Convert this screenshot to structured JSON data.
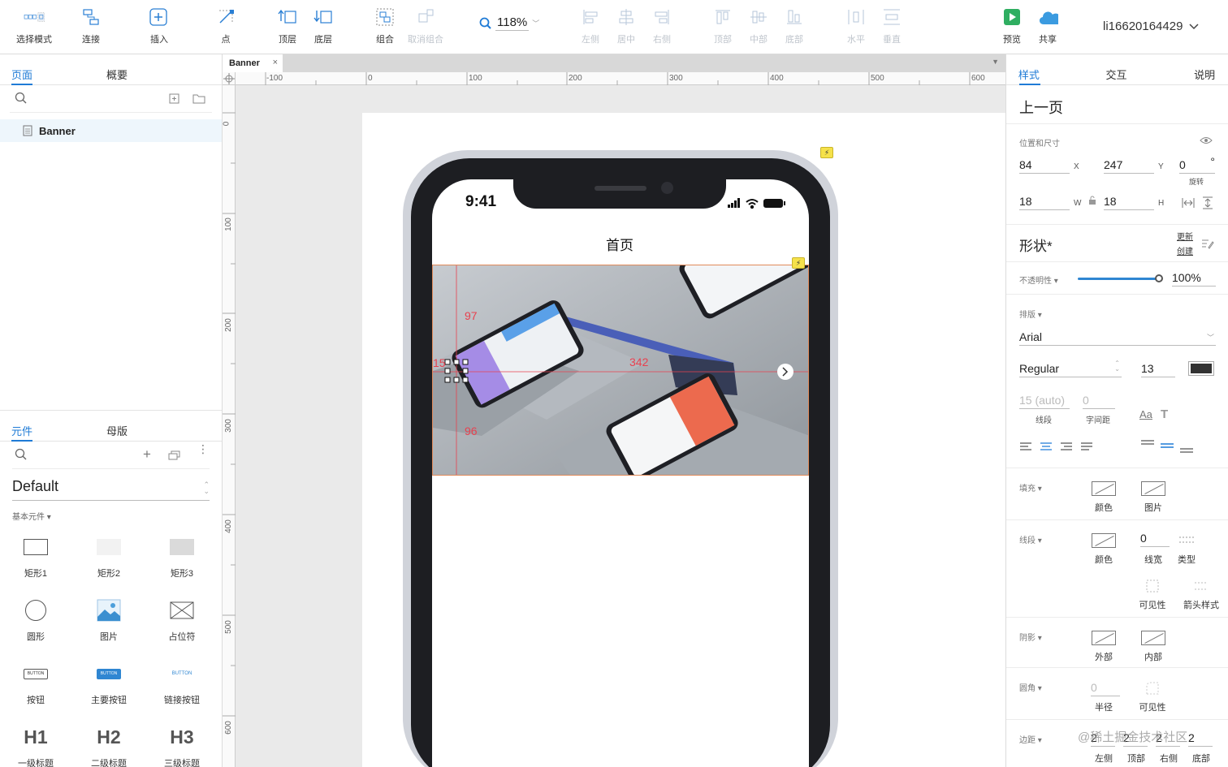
{
  "toolbar": {
    "select_mode": "选择模式",
    "connect": "连接",
    "insert": "插入",
    "point": "点",
    "top_layer": "顶层",
    "bottom_layer": "底层",
    "group": "组合",
    "ungroup": "取消组合",
    "zoom": "118%",
    "align_left": "左侧",
    "align_center": "居中",
    "align_right": "右侧",
    "align_top": "顶部",
    "align_middle": "中部",
    "align_bottom": "底部",
    "distribute_h": "水平",
    "distribute_v": "垂直",
    "preview": "预览",
    "share": "共享",
    "user": "li16620164429"
  },
  "left": {
    "tab_pages": "页面",
    "tab_outline": "概要",
    "page_name": "Banner",
    "tab_widgets": "元件",
    "tab_masters": "母版",
    "library": "Default",
    "category": "基本元件 ▾",
    "widgets": [
      {
        "label": "矩形1"
      },
      {
        "label": "矩形2"
      },
      {
        "label": "矩形3"
      },
      {
        "label": "圆形"
      },
      {
        "label": "图片"
      },
      {
        "label": "占位符"
      },
      {
        "label": "按钮"
      },
      {
        "label": "主要按钮"
      },
      {
        "label": "链接按钮"
      },
      {
        "label": "一级标题"
      },
      {
        "label": "二级标题"
      },
      {
        "label": "三级标题"
      }
    ],
    "btn_text": "BUTTON",
    "h1": "H1",
    "h2": "H2",
    "h3": "H3"
  },
  "canvas": {
    "doc_tab": "Banner",
    "ruler_h": [
      "-100",
      "0",
      "100",
      "200",
      "300",
      "400",
      "500",
      "600"
    ],
    "ruler_v": [
      "0",
      "100",
      "200",
      "300",
      "400",
      "500",
      "600"
    ],
    "status_time": "9:41",
    "page_title": "首页",
    "measure_top": "97",
    "measure_bottom": "96",
    "measure_left": "15",
    "measure_right": "342"
  },
  "right": {
    "tab_style": "样式",
    "tab_interact": "交互",
    "tab_notes": "说明",
    "widget_name": "上一页",
    "pos_size_label": "位置和尺寸",
    "x": "84",
    "x_label": "X",
    "y": "247",
    "y_label": "Y",
    "rotation": "0",
    "rotation_unit": "°",
    "rotation_label": "旋转",
    "w": "18",
    "w_label": "W",
    "h": "18",
    "h_label": "H",
    "shape_title": "形状*",
    "update": "更新",
    "create": "创建",
    "opacity_label": "不透明性 ▾",
    "opacity": "100%",
    "typography_label": "排版 ▾",
    "font": "Arial",
    "weight": "Regular",
    "size": "13",
    "line_spacing": "15 (auto)",
    "line_spacing_label": "线段",
    "char_spacing": "0",
    "char_spacing_label": "字间距",
    "fill_label": "填充 ▾",
    "fill_color": "颜色",
    "fill_image": "图片",
    "border_label": "线段 ▾",
    "border_color": "颜色",
    "border_width": "0",
    "border_width_label": "线宽",
    "border_type": "类型",
    "visibility": "可见性",
    "arrow_style": "箭头样式",
    "shadow_label": "阴影 ▾",
    "shadow_outer": "外部",
    "shadow_inner": "内部",
    "corner_label": "圆角 ▾",
    "radius": "0",
    "radius_label": "半径",
    "corner_vis": "可见性",
    "padding_label": "边距 ▾",
    "padding_values": [
      "2",
      "2",
      "2",
      "2"
    ],
    "pad_left": "左侧",
    "pad_top": "顶部",
    "pad_right": "右侧",
    "pad_bottom": "底部",
    "watermark": "@稀土掘金技术社区"
  },
  "colors": {
    "accent": "#1f7bd6",
    "measure": "#e8414f",
    "text_swatch": "#333333"
  }
}
